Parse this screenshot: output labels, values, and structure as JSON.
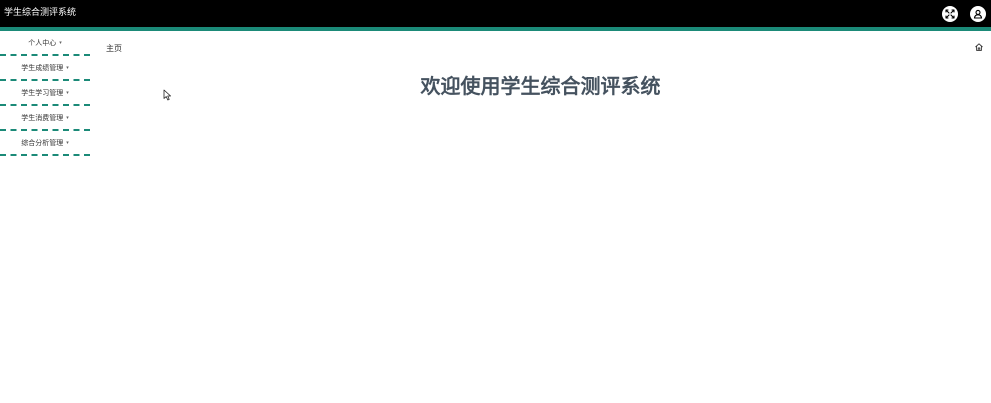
{
  "app": {
    "title": "学生综合测评系统"
  },
  "header": {
    "fullscreen_icon": "fullscreen-icon",
    "user_icon": "user-icon"
  },
  "sidebar": {
    "items": [
      {
        "label": "个人中心"
      },
      {
        "label": "学生成绩管理"
      },
      {
        "label": "学生学习管理"
      },
      {
        "label": "学生消费管理"
      },
      {
        "label": "综合分析管理"
      }
    ],
    "caret": "▾"
  },
  "breadcrumb": {
    "label": "主页"
  },
  "main": {
    "welcome": "欢迎使用学生综合测评系统"
  },
  "colors": {
    "topbar": "#000000",
    "accent": "#1b8a78",
    "heading": "#45525f"
  }
}
